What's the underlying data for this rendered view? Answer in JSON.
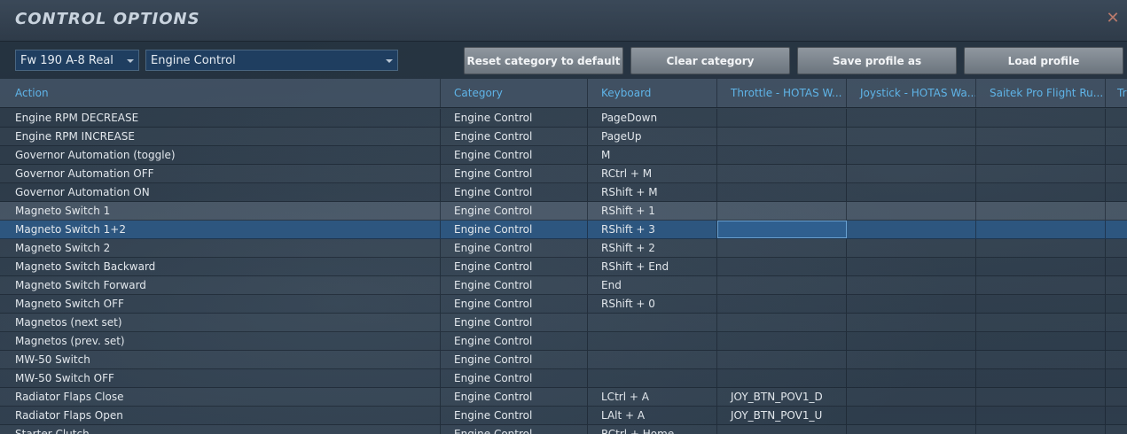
{
  "window": {
    "title": "CONTROL OPTIONS"
  },
  "toolbar": {
    "aircraft": "Fw 190 A-8 Real",
    "category": "Engine Control",
    "reset_label": "Reset category to default",
    "clear_label": "Clear category",
    "save_label": "Save profile as",
    "load_label": "Load profile"
  },
  "table": {
    "columns": [
      "Action",
      "Category",
      "Keyboard",
      "Throttle - HOTAS W...",
      "Joystick - HOTAS Wa...",
      "Saitek Pro Flight Ru...",
      "Tr"
    ],
    "rows": [
      {
        "action": "Engine RPM DECREASE",
        "category": "Engine Control",
        "keyboard": "PageDown",
        "throttle": "",
        "joystick": "",
        "saitek": ""
      },
      {
        "action": "Engine RPM INCREASE",
        "category": "Engine Control",
        "keyboard": "PageUp",
        "throttle": "",
        "joystick": "",
        "saitek": ""
      },
      {
        "action": "Governor Automation (toggle)",
        "category": "Engine Control",
        "keyboard": "M",
        "throttle": "",
        "joystick": "",
        "saitek": ""
      },
      {
        "action": "Governor Automation OFF",
        "category": "Engine Control",
        "keyboard": "RCtrl + M",
        "throttle": "",
        "joystick": "",
        "saitek": ""
      },
      {
        "action": "Governor Automation ON",
        "category": "Engine Control",
        "keyboard": "RShift + M",
        "throttle": "",
        "joystick": "",
        "saitek": ""
      },
      {
        "action": "Magneto Switch 1",
        "category": "Engine Control",
        "keyboard": "RShift + 1",
        "throttle": "",
        "joystick": "",
        "saitek": ""
      },
      {
        "action": "Magneto Switch 1+2",
        "category": "Engine Control",
        "keyboard": "RShift + 3",
        "throttle": "",
        "joystick": "",
        "saitek": ""
      },
      {
        "action": "Magneto Switch 2",
        "category": "Engine Control",
        "keyboard": "RShift + 2",
        "throttle": "",
        "joystick": "",
        "saitek": ""
      },
      {
        "action": "Magneto Switch Backward",
        "category": "Engine Control",
        "keyboard": "RShift + End",
        "throttle": "",
        "joystick": "",
        "saitek": ""
      },
      {
        "action": "Magneto Switch Forward",
        "category": "Engine Control",
        "keyboard": "End",
        "throttle": "",
        "joystick": "",
        "saitek": ""
      },
      {
        "action": "Magneto Switch OFF",
        "category": "Engine Control",
        "keyboard": "RShift + 0",
        "throttle": "",
        "joystick": "",
        "saitek": ""
      },
      {
        "action": "Magnetos (next set)",
        "category": "Engine Control",
        "keyboard": "",
        "throttle": "",
        "joystick": "",
        "saitek": ""
      },
      {
        "action": "Magnetos (prev. set)",
        "category": "Engine Control",
        "keyboard": "",
        "throttle": "",
        "joystick": "",
        "saitek": ""
      },
      {
        "action": "MW-50 Switch",
        "category": "Engine Control",
        "keyboard": "",
        "throttle": "",
        "joystick": "",
        "saitek": ""
      },
      {
        "action": "MW-50 Switch OFF",
        "category": "Engine Control",
        "keyboard": "",
        "throttle": "",
        "joystick": "",
        "saitek": ""
      },
      {
        "action": "Radiator Flaps Close",
        "category": "Engine Control",
        "keyboard": "LCtrl + A",
        "throttle": "JOY_BTN_POV1_D",
        "joystick": "",
        "saitek": ""
      },
      {
        "action": "Radiator Flaps Open",
        "category": "Engine Control",
        "keyboard": "LAlt + A",
        "throttle": "JOY_BTN_POV1_U",
        "joystick": "",
        "saitek": ""
      },
      {
        "action": "Starter Clutch",
        "category": "Engine Control",
        "keyboard": "RCtrl + Home",
        "throttle": "",
        "joystick": "",
        "saitek": ""
      }
    ]
  }
}
